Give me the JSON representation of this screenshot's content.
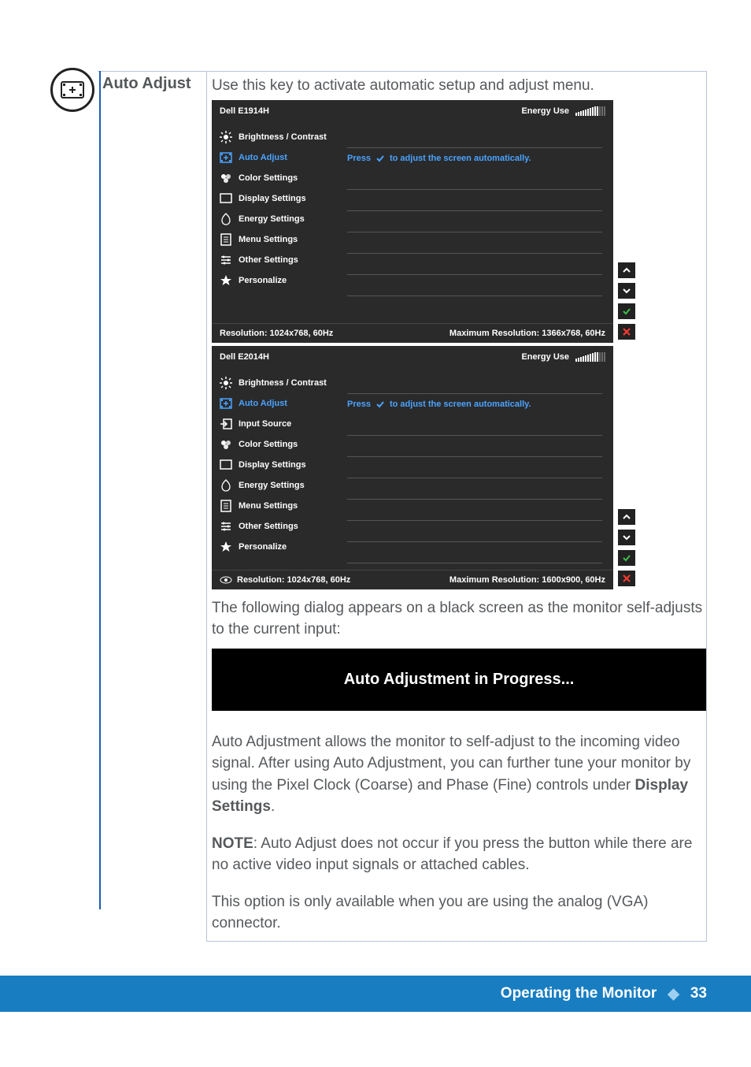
{
  "heading": "Auto Adjust",
  "intro": "Use this key to activate automatic setup and adjust menu.",
  "osd1": {
    "model": "Dell E1914H",
    "energy_label": "Energy Use",
    "hint_prefix": "Press",
    "hint_suffix": "to adjust the screen automatically.",
    "menu": [
      {
        "label": "Brightness / Contrast",
        "icon": "brightness-icon"
      },
      {
        "label": "Auto Adjust",
        "icon": "auto-adjust-icon",
        "selected": true
      },
      {
        "label": "Color Settings",
        "icon": "color-icon"
      },
      {
        "label": "Display Settings",
        "icon": "display-icon"
      },
      {
        "label": "Energy Settings",
        "icon": "energy-icon"
      },
      {
        "label": "Menu Settings",
        "icon": "menu-icon"
      },
      {
        "label": "Other Settings",
        "icon": "other-icon"
      },
      {
        "label": "Personalize",
        "icon": "star-icon"
      }
    ],
    "res": "Resolution: 1024x768, 60Hz",
    "max": "Maximum Resolution: 1366x768, 60Hz"
  },
  "osd2": {
    "model": "Dell E2014H",
    "energy_label": "Energy Use",
    "hint_prefix": "Press",
    "hint_suffix": "to adjust the screen automatically.",
    "menu": [
      {
        "label": "Brightness / Contrast",
        "icon": "brightness-icon"
      },
      {
        "label": "Auto Adjust",
        "icon": "auto-adjust-icon",
        "selected": true
      },
      {
        "label": "Input Source",
        "icon": "input-icon"
      },
      {
        "label": "Color Settings",
        "icon": "color-icon"
      },
      {
        "label": "Display Settings",
        "icon": "display-icon"
      },
      {
        "label": "Energy Settings",
        "icon": "energy-icon"
      },
      {
        "label": "Menu Settings",
        "icon": "menu-icon"
      },
      {
        "label": "Other Settings",
        "icon": "other-icon"
      },
      {
        "label": "Personalize",
        "icon": "star-icon"
      }
    ],
    "res": "Resolution: 1024x768, 60Hz",
    "max": "Maximum Resolution: 1600x900, 60Hz"
  },
  "after_osd": "The following dialog appears on a black screen as the monitor self-adjusts to the current input:",
  "progress": "Auto Adjustment in Progress...",
  "para1a": "Auto Adjustment allows the monitor to self-adjust to the incoming video signal. After using Auto Adjustment, you can further tune your monitor by using the Pixel Clock (Coarse) and Phase (Fine) controls under ",
  "para1b": "Display Settings",
  "para1c": ".",
  "note_label": "NOTE",
  "note_text": ": Auto Adjust does not occur if you press the button while there are no active video input signals or attached cables.",
  "para2": "This option is only available when you are using the analog (VGA) connector.",
  "footer": {
    "section": "Operating the Monitor",
    "page": "33"
  }
}
